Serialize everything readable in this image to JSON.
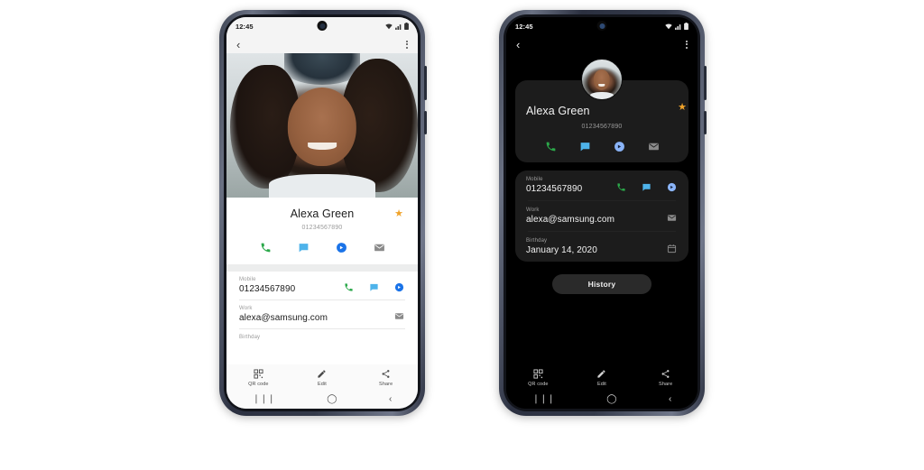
{
  "scene": {
    "background": "#ffffff",
    "description": "Two Samsung phones side by side showing a contact detail screen in light theme and dark theme"
  },
  "phones": [
    {
      "id": "light-phone",
      "theme": "light",
      "status_bar": {
        "time": "12:45",
        "wifi_icon": "wifi-icon",
        "signal_icon": "signal-bars-icon",
        "battery_icon": "battery-icon"
      },
      "app_bar": {
        "back_icon": "back-arrow-icon",
        "more_icon": "more-options-icon"
      },
      "hero": {
        "type": "contact-photo",
        "alt": "Portrait photo of smiling woman with curly hair"
      },
      "contact": {
        "name": "Alexa Green",
        "number": "01234567890",
        "favorite": true,
        "star_color": "#f0a32a",
        "actions": [
          {
            "name": "call-action",
            "icon": "phone-icon",
            "color": "#2ba84a"
          },
          {
            "name": "message-action",
            "icon": "message-icon",
            "color": "#4eb3ea"
          },
          {
            "name": "duo-video-action",
            "icon": "video-call-icon",
            "color": "#1a73e8"
          },
          {
            "name": "email-action",
            "icon": "email-icon",
            "color": "#8a8a8a"
          }
        ]
      },
      "details": [
        {
          "label": "Mobile",
          "value": "01234567890",
          "icons": [
            {
              "name": "call-icon",
              "icon": "phone-icon",
              "color": "#2ba84a"
            },
            {
              "name": "message-icon",
              "icon": "message-icon",
              "color": "#4eb3ea"
            },
            {
              "name": "video-call-icon",
              "icon": "video-call-icon",
              "color": "#1a73e8"
            }
          ]
        },
        {
          "label": "Work",
          "value": "alexa@samsung.com",
          "icons": [
            {
              "name": "email-icon",
              "icon": "email-icon",
              "color": "#8a8a8a"
            }
          ]
        },
        {
          "label": "Birthday",
          "value": "",
          "icons": []
        }
      ],
      "toolbar": [
        {
          "label": "QR code",
          "icon": "qr-code-icon"
        },
        {
          "label": "Edit",
          "icon": "pencil-icon"
        },
        {
          "label": "Share",
          "icon": "share-icon"
        }
      ],
      "nav_bar": [
        {
          "name": "recents-button",
          "glyph": "❘❘❘"
        },
        {
          "name": "home-button",
          "glyph": "◯"
        },
        {
          "name": "back-button",
          "glyph": "‹"
        }
      ]
    },
    {
      "id": "dark-phone",
      "theme": "dark",
      "status_bar": {
        "time": "12:45",
        "wifi_icon": "wifi-icon",
        "signal_icon": "signal-bars-icon",
        "battery_icon": "battery-icon"
      },
      "app_bar": {
        "back_icon": "back-arrow-icon",
        "more_icon": "more-options-icon"
      },
      "avatar": {
        "type": "contact-avatar",
        "alt": "Circular portrait photo of smiling woman"
      },
      "contact": {
        "name": "Alexa Green",
        "number": "01234567890",
        "favorite": true,
        "star_color": "#f0a32a",
        "actions": [
          {
            "name": "call-action",
            "icon": "phone-icon",
            "color": "#2ba84a"
          },
          {
            "name": "message-action",
            "icon": "message-icon",
            "color": "#4eb3ea"
          },
          {
            "name": "duo-video-action",
            "icon": "video-call-icon",
            "color": "#8ab4f8"
          },
          {
            "name": "email-action",
            "icon": "email-icon",
            "color": "#8a8a8a"
          }
        ]
      },
      "details": [
        {
          "label": "Mobile",
          "value": "01234567890",
          "icons": [
            {
              "name": "call-icon",
              "icon": "phone-icon",
              "color": "#2ba84a"
            },
            {
              "name": "message-icon",
              "icon": "message-icon",
              "color": "#4eb3ea"
            },
            {
              "name": "video-call-icon",
              "icon": "video-call-icon",
              "color": "#8ab4f8"
            }
          ]
        },
        {
          "label": "Work",
          "value": "alexa@samsung.com",
          "icons": [
            {
              "name": "email-icon",
              "icon": "email-icon",
              "color": "#8a8a8a"
            }
          ]
        },
        {
          "label": "Birthday",
          "value": "January 14, 2020",
          "icons": [
            {
              "name": "calendar-icon",
              "icon": "calendar-icon",
              "color": "#8a8a8a"
            }
          ]
        }
      ],
      "history_button": {
        "label": "History"
      },
      "toolbar": [
        {
          "label": "QR code",
          "icon": "qr-code-icon"
        },
        {
          "label": "Edit",
          "icon": "pencil-icon"
        },
        {
          "label": "Share",
          "icon": "share-icon"
        }
      ],
      "nav_bar": [
        {
          "name": "recents-button",
          "glyph": "❘❘❘"
        },
        {
          "name": "home-button",
          "glyph": "◯"
        },
        {
          "name": "back-button",
          "glyph": "‹"
        }
      ]
    }
  ]
}
